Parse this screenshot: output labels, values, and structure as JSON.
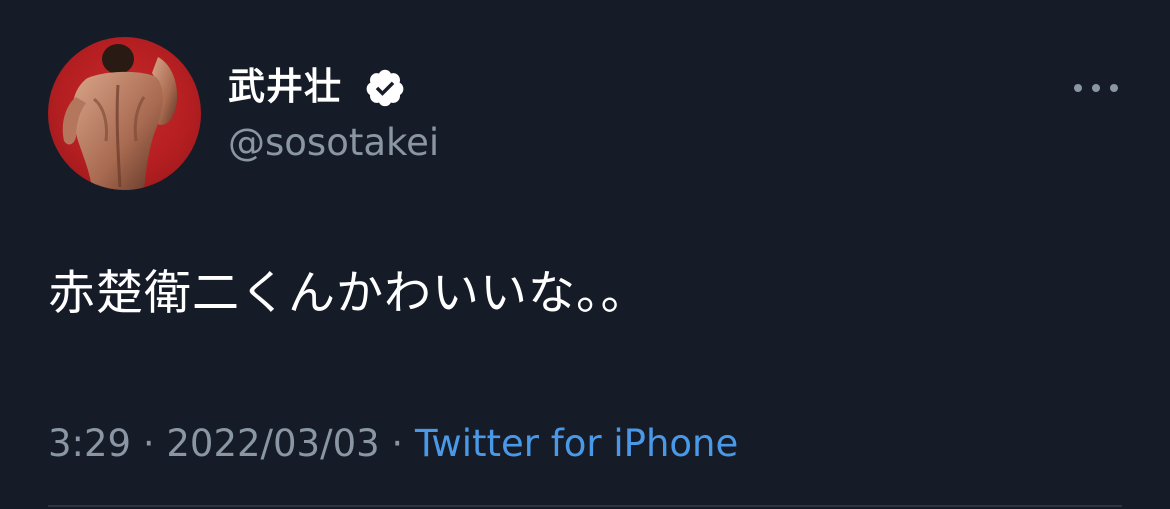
{
  "tweet": {
    "author": {
      "display_name": "武井壮",
      "handle": "@sosotakei",
      "verified": true,
      "avatar": "muscular-back-on-red-avatar"
    },
    "more_icon": "more-horizontal-icon",
    "text": "赤楚衛二くんかわいいな。。",
    "time": "3:29",
    "separator": " · ",
    "date": "2022/03/03",
    "source": "Twitter for iPhone"
  },
  "colors": {
    "background": "#161c27",
    "text": "#ffffff",
    "muted": "#8a96a3",
    "link": "#4a99e9",
    "avatar_red": "#b61f22"
  }
}
